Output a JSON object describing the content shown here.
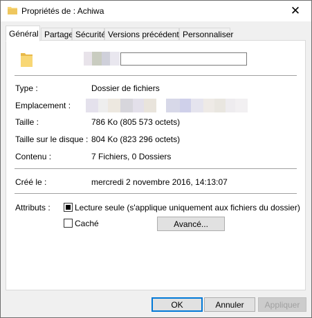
{
  "window": {
    "title": "Propriétés de : Achiwa",
    "close_glyph": "✕"
  },
  "tabs": [
    {
      "label": "Général",
      "active": true
    },
    {
      "label": "Partage",
      "active": false
    },
    {
      "label": "Sécurité",
      "active": false
    },
    {
      "label": "Versions précédentes",
      "active": false
    },
    {
      "label": "Personnaliser",
      "active": false
    }
  ],
  "general": {
    "name_value": "",
    "type": {
      "label": "Type :",
      "value": "Dossier de fichiers"
    },
    "location": {
      "label": "Emplacement :"
    },
    "size": {
      "label": "Taille :",
      "value": "786 Ko (805 573 octets)"
    },
    "size_on_disk": {
      "label": "Taille sur le disque :",
      "value": "804 Ko (823 296 octets)"
    },
    "contents": {
      "label": "Contenu :",
      "value": "7 Fichiers, 0 Dossiers"
    },
    "created": {
      "label": "Créé le :",
      "value": "mercredi 2 novembre 2016, 14:13:07"
    },
    "attributes": {
      "label": "Attributs :",
      "readonly": {
        "label": "Lecture seule (s'applique uniquement aux fichiers du dossier)",
        "checked": "indeterminate"
      },
      "hidden": {
        "label": "Caché",
        "checked": false
      },
      "advanced_label": "Avancé..."
    }
  },
  "footer": {
    "ok_label": "OK",
    "cancel_label": "Annuler",
    "apply_label": "Appliquer"
  },
  "colors": {
    "folder": "#f8d775",
    "folder_dark": "#e8b94a",
    "default_button_border": "#0078d7"
  },
  "icons": {
    "title": "folder-icon",
    "general": "folder-icon",
    "close": "close-icon"
  }
}
